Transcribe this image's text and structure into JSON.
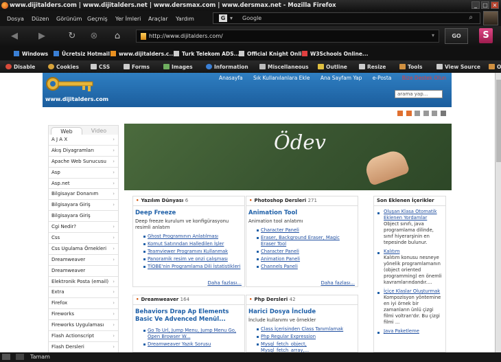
{
  "window": {
    "title": "www.dijitalders.com | www.dijitalders.net | www.dersmax.com | www.dersmax.net - Mozilla Firefox",
    "controls": [
      "_",
      "□",
      "×"
    ]
  },
  "menu": [
    "Dosya",
    "Düzen",
    "Görünüm",
    "Geçmiş",
    "Yer İmleri",
    "Araçlar",
    "Yardım"
  ],
  "search": {
    "engine_label": "Google",
    "icon": "G"
  },
  "nav": {
    "url": "http://www.dijitalders.com/",
    "go_label": "GO",
    "stumble_label": "S"
  },
  "bookmarks": [
    {
      "label": "Windows",
      "color": "#3a7fd5"
    },
    {
      "label": "Ücretsiz Hotmail",
      "color": "#3a7fd5"
    },
    {
      "label": "www.dijitalders.c...",
      "color": "#e89020"
    },
    {
      "label": "Turk Telekom ADS...",
      "color": "#cccccc"
    },
    {
      "label": "Official Knight Onli...",
      "color": "#cccccc"
    },
    {
      "label": "W3Schools Online...",
      "color": "#e04040"
    }
  ],
  "devtools": [
    {
      "label": "Disable",
      "color": "#d84a3a"
    },
    {
      "label": "Cookies",
      "color": "#d8a33a"
    },
    {
      "label": "CSS",
      "color": "#cccccc"
    },
    {
      "label": "Forms",
      "color": "#cccccc"
    },
    {
      "label": "Images",
      "color": "#6fae5f"
    },
    {
      "label": "Information",
      "color": "#3a7fd5"
    },
    {
      "label": "Miscellaneous",
      "color": "#bbbbbb"
    },
    {
      "label": "Outline",
      "color": "#e0c040"
    },
    {
      "label": "Resize",
      "color": "#cccccc"
    },
    {
      "label": "Tools",
      "color": "#d09040"
    },
    {
      "label": "View Source",
      "color": "#cccccc"
    },
    {
      "label": "O",
      "color": "#d09040"
    }
  ],
  "site": {
    "title": "www.dijitalders.com",
    "topnav": [
      "Anasayfa",
      "Sık Kullanılanlara Ekle",
      "Ana Sayfam Yap",
      "e-Posta",
      "Bize Destek Olun"
    ],
    "search_placeholder": "arama yap...",
    "hero_text": "Ödev",
    "sidebar_tabs": [
      "Web",
      "Video"
    ],
    "sidebar_items": [
      "A J A X",
      "Akış Diyagramları",
      "Apache Web Sunucusu",
      "Asp",
      "Asp.net",
      "Bilgisayar Donanım",
      "Bilgisayara Giriş",
      "Bilgisayara Giriş Uygulamaları",
      "Cgi Nedir?",
      "Css",
      "Css Ugulama Örnekleri",
      "Dreamweaver",
      "Dreamweaver Uygulamaları",
      "Elektronik Posta (email)",
      "Extra",
      "Firefox",
      "Fireworks",
      "Fireworks Uygulaması",
      "Flash Actionscript",
      "Flash Dersleri"
    ],
    "boxes": [
      {
        "category": "Yazılım Dünyası",
        "count": "6",
        "title": "Deep Freeze",
        "desc": "Deep freeze kurulum ve konfigürasyonu resimli anlatım",
        "links": [
          "Ghost Programının Anlatılması",
          "Komut Satırından Halledilen İşler",
          "Teamviewer Programını Kullanmak",
          "Panoramik resim ve onzi çalışması",
          "TİOBE'nin Programlama Dili İstatistikleri"
        ],
        "more": "Daha fazlası..."
      },
      {
        "category": "Photoshop Dersleri",
        "count": "271",
        "title": "Animation Tool",
        "desc": "Animation tool anlatımı",
        "links": [
          "Character Paneli",
          "Eraser, Background Eraser, Magic Eraser Tool",
          "Character Paneli",
          "Animation Paneli",
          "Channels Paneli"
        ],
        "more": "Daha fazlası..."
      },
      {
        "category": "Dreamweaver",
        "count": "164",
        "title": "Behaviors Drap Ap Elements Basic Ve Advenced Menül...",
        "desc": "",
        "links": [
          "Go To Url, Jump Menu, Jump Menu Go, Open Browser W...",
          "Dreamweaver Yazık Sorusu"
        ],
        "more": ""
      },
      {
        "category": "Php Dersleri",
        "count": "42",
        "title": "Harici Dosya İnclude",
        "desc": "İnclude kullanımı ve örnekler",
        "links": [
          "Class İçerisinden Class Tanımlamak",
          "Php Regular Expression",
          "Mysql_fetch_object, Mysql_fetch_array,..."
        ],
        "more": ""
      }
    ],
    "recent": {
      "title": "Son Eklenen İçerikler",
      "items": [
        {
          "title": "Oluşan Klasa Otomatik Eklenen Yordamlar",
          "desc": "Object sınıfı, java programlama dilinde, sınıf hiyerarşinin en tepesinde bulunur."
        },
        {
          "title": "Kalıtım",
          "desc": "Kalıtım konusu nesneye yönelik programlamanın (object oriented programming) en önemli kavramlarındandır...."
        },
        {
          "title": "İçiçe Klaslar Oluşturmak",
          "desc": "Kompozisyon yöntemine en iyi örnek bir zamanların ünlü çizgi filmi voltran'dır. Bu çizgi filmi ..."
        },
        {
          "title": "Java Paketleme",
          "desc": ""
        }
      ]
    }
  },
  "status": {
    "text": "Tamam"
  }
}
